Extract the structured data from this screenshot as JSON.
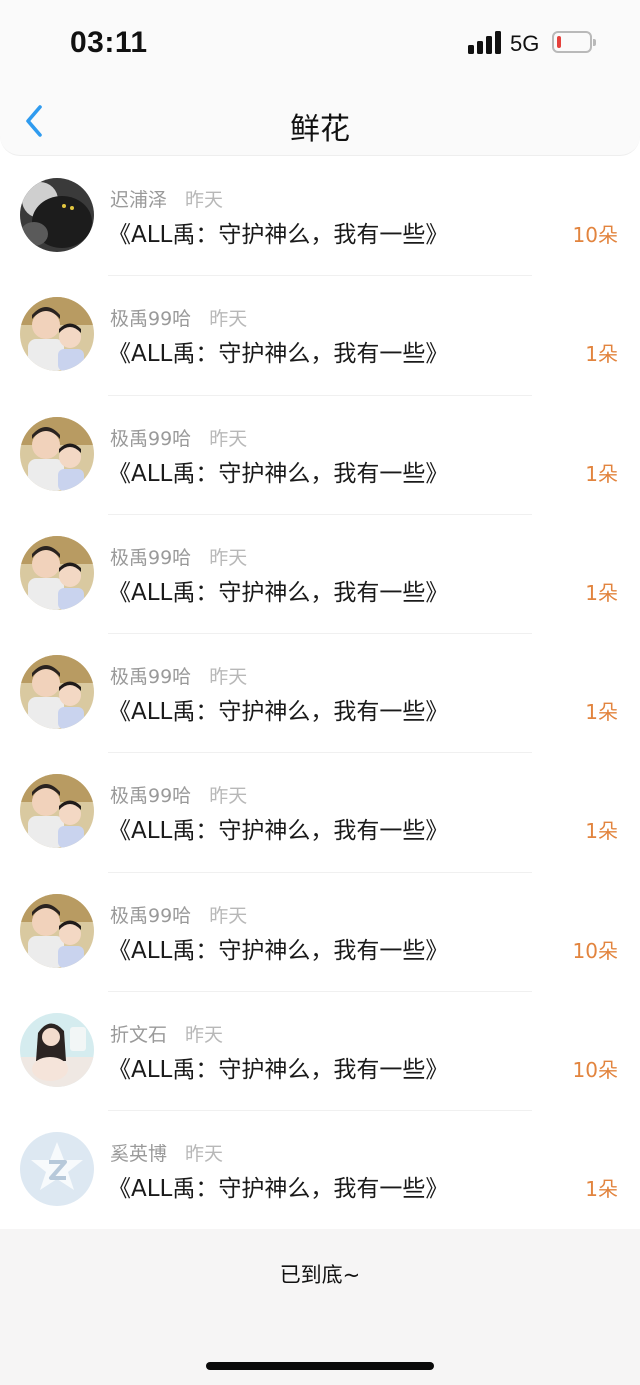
{
  "status_bar": {
    "time": "03:11",
    "network": "5G",
    "battery_level": 0.1,
    "signal_bars": 4
  },
  "nav": {
    "title": "鲜花",
    "back_icon": "chevron-left-icon"
  },
  "colors": {
    "accent": "#2f9bef",
    "amount": "#e2843e",
    "battery_low": "#e5413c"
  },
  "rows": [
    {
      "name": "迟浦泽",
      "time": "昨天",
      "title": "《ALL禹：守护神么，我有一些》",
      "amount": "10朵",
      "avatar": "dark-cat-avatar"
    },
    {
      "name": "极禹99哈",
      "time": "昨天",
      "title": "《ALL禹：守护神么，我有一些》",
      "amount": "1朵",
      "avatar": "two-boys-avatar"
    },
    {
      "name": "极禹99哈",
      "time": "昨天",
      "title": "《ALL禹：守护神么，我有一些》",
      "amount": "1朵",
      "avatar": "two-boys-avatar"
    },
    {
      "name": "极禹99哈",
      "time": "昨天",
      "title": "《ALL禹：守护神么，我有一些》",
      "amount": "1朵",
      "avatar": "two-boys-avatar"
    },
    {
      "name": "极禹99哈",
      "time": "昨天",
      "title": "《ALL禹：守护神么，我有一些》",
      "amount": "1朵",
      "avatar": "two-boys-avatar"
    },
    {
      "name": "极禹99哈",
      "time": "昨天",
      "title": "《ALL禹：守护神么，我有一些》",
      "amount": "1朵",
      "avatar": "two-boys-avatar"
    },
    {
      "name": "极禹99哈",
      "time": "昨天",
      "title": "《ALL禹：守护神么，我有一些》",
      "amount": "10朵",
      "avatar": "two-boys-avatar"
    },
    {
      "name": "折文石",
      "time": "昨天",
      "title": "《ALL禹：守护神么，我有一些》",
      "amount": "10朵",
      "avatar": "girl-photo-avatar"
    },
    {
      "name": "奚英博",
      "time": "昨天",
      "title": "《ALL禹：守护神么，我有一些》",
      "amount": "1朵",
      "avatar": "default-z-avatar"
    }
  ],
  "footer": {
    "end_text": "已到底~"
  }
}
